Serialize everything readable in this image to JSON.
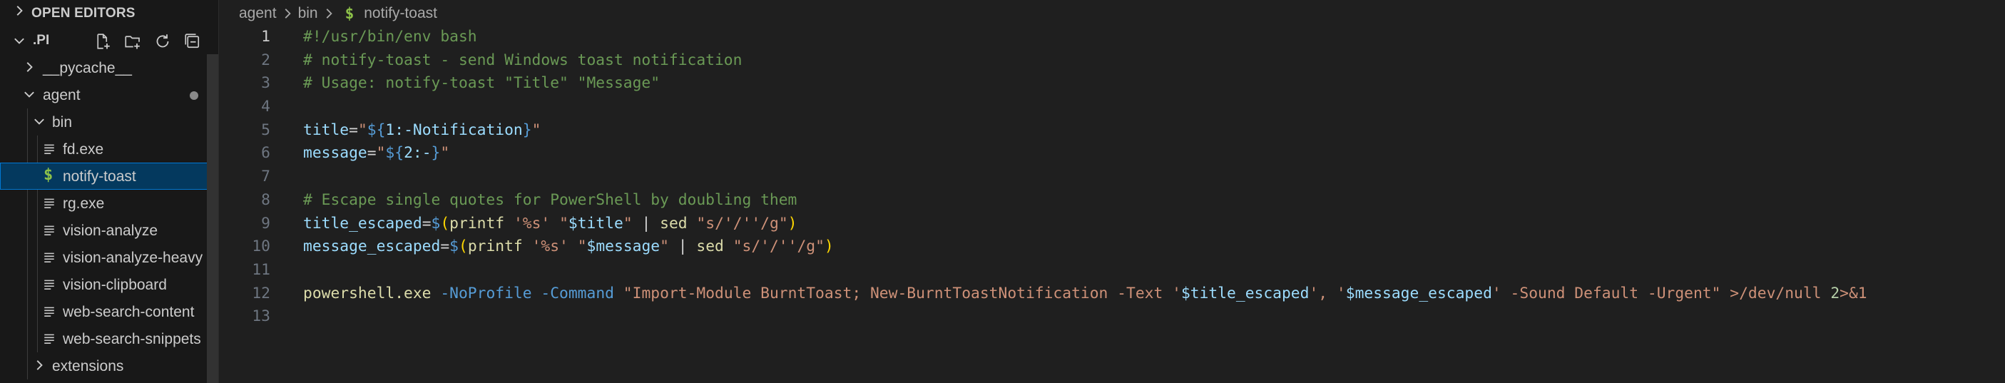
{
  "explorer": {
    "open_editors_label": "OPEN EDITORS",
    "folder_label": ".PI",
    "actions": [
      {
        "name": "new-file-icon"
      },
      {
        "name": "new-folder-icon"
      },
      {
        "name": "refresh-icon"
      },
      {
        "name": "collapse-all-icon"
      }
    ],
    "tree": [
      {
        "label": "__pycache__",
        "kind": "folder",
        "expanded": false
      },
      {
        "label": "agent",
        "kind": "folder",
        "expanded": true,
        "modified": true
      },
      {
        "label": "bin",
        "kind": "folder",
        "expanded": true
      },
      {
        "label": "fd.exe",
        "kind": "file"
      },
      {
        "label": "notify-toast",
        "kind": "shell",
        "selected": true
      },
      {
        "label": "rg.exe",
        "kind": "file"
      },
      {
        "label": "vision-analyze",
        "kind": "file"
      },
      {
        "label": "vision-analyze-heavy",
        "kind": "file"
      },
      {
        "label": "vision-clipboard",
        "kind": "file"
      },
      {
        "label": "web-search-content",
        "kind": "file"
      },
      {
        "label": "web-search-snippets",
        "kind": "file"
      },
      {
        "label": "extensions",
        "kind": "folder",
        "expanded": false
      }
    ]
  },
  "breadcrumb": {
    "items": [
      "agent",
      "bin"
    ],
    "file_icon": "$",
    "file": "notify-toast"
  },
  "editor": {
    "active_line": 1,
    "line_numbers": [
      "1",
      "2",
      "3",
      "4",
      "5",
      "6",
      "7",
      "8",
      "9",
      "10",
      "11",
      "12",
      "13"
    ],
    "lines": [
      [
        {
          "c": "com",
          "t": "#!/usr/bin/env bash"
        }
      ],
      [
        {
          "c": "com",
          "t": "# notify-toast - send Windows toast notification"
        }
      ],
      [
        {
          "c": "com",
          "t": "# Usage: notify-toast \"Title\" \"Message\""
        }
      ],
      [],
      [
        {
          "c": "var",
          "t": "title"
        },
        {
          "c": "txt",
          "t": "="
        },
        {
          "c": "str",
          "t": "\""
        },
        {
          "c": "par",
          "t": "${"
        },
        {
          "c": "var",
          "t": "1:-Notification"
        },
        {
          "c": "par",
          "t": "}"
        },
        {
          "c": "str",
          "t": "\""
        }
      ],
      [
        {
          "c": "var",
          "t": "message"
        },
        {
          "c": "txt",
          "t": "="
        },
        {
          "c": "str",
          "t": "\""
        },
        {
          "c": "par",
          "t": "${"
        },
        {
          "c": "var",
          "t": "2:-"
        },
        {
          "c": "par",
          "t": "}"
        },
        {
          "c": "str",
          "t": "\""
        }
      ],
      [],
      [
        {
          "c": "com",
          "t": "# Escape single quotes for PowerShell by doubling them"
        }
      ],
      [
        {
          "c": "var",
          "t": "title_escaped"
        },
        {
          "c": "txt",
          "t": "="
        },
        {
          "c": "par",
          "t": "$"
        },
        {
          "c": "brk",
          "t": "("
        },
        {
          "c": "fn",
          "t": "printf"
        },
        {
          "c": "txt",
          "t": " "
        },
        {
          "c": "str",
          "t": "'%s'"
        },
        {
          "c": "txt",
          "t": " "
        },
        {
          "c": "str",
          "t": "\""
        },
        {
          "c": "var",
          "t": "$title"
        },
        {
          "c": "str",
          "t": "\""
        },
        {
          "c": "txt",
          "t": " | "
        },
        {
          "c": "fn",
          "t": "sed"
        },
        {
          "c": "txt",
          "t": " "
        },
        {
          "c": "str",
          "t": "\"s/'/''/g\""
        },
        {
          "c": "brk",
          "t": ")"
        }
      ],
      [
        {
          "c": "var",
          "t": "message_escaped"
        },
        {
          "c": "txt",
          "t": "="
        },
        {
          "c": "par",
          "t": "$"
        },
        {
          "c": "brk",
          "t": "("
        },
        {
          "c": "fn",
          "t": "printf"
        },
        {
          "c": "txt",
          "t": " "
        },
        {
          "c": "str",
          "t": "'%s'"
        },
        {
          "c": "txt",
          "t": " "
        },
        {
          "c": "str",
          "t": "\""
        },
        {
          "c": "var",
          "t": "$message"
        },
        {
          "c": "str",
          "t": "\""
        },
        {
          "c": "txt",
          "t": " | "
        },
        {
          "c": "fn",
          "t": "sed"
        },
        {
          "c": "txt",
          "t": " "
        },
        {
          "c": "str",
          "t": "\"s/'/''/g\""
        },
        {
          "c": "brk",
          "t": ")"
        }
      ],
      [],
      [
        {
          "c": "fn",
          "t": "powershell.exe"
        },
        {
          "c": "txt",
          "t": " "
        },
        {
          "c": "par",
          "t": "-NoProfile"
        },
        {
          "c": "txt",
          "t": " "
        },
        {
          "c": "par",
          "t": "-Command"
        },
        {
          "c": "txt",
          "t": " "
        },
        {
          "c": "str",
          "t": "\"Import-Module BurntToast; New-BurntToastNotification -Text '"
        },
        {
          "c": "var",
          "t": "$title_escaped"
        },
        {
          "c": "str",
          "t": "', '"
        },
        {
          "c": "var",
          "t": "$message_escaped"
        },
        {
          "c": "str",
          "t": "' -Sound Default -Urgent\""
        },
        {
          "c": "txt",
          "t": " "
        },
        {
          "c": "str",
          "t": ">/dev/null"
        },
        {
          "c": "txt",
          "t": " "
        },
        {
          "c": "num",
          "t": "2"
        },
        {
          "c": "str",
          "t": ">&1"
        }
      ],
      []
    ]
  },
  "colors": {
    "background": "#1f1f1f",
    "sidebar": "#181818",
    "selection": "#04395e",
    "focus_border": "#0078d4",
    "comment": "#6a9955",
    "variable": "#9cdcfe",
    "string": "#ce9178",
    "function": "#dcdcaa",
    "keyword": "#569cd6",
    "shell_icon": "#8dc149"
  }
}
